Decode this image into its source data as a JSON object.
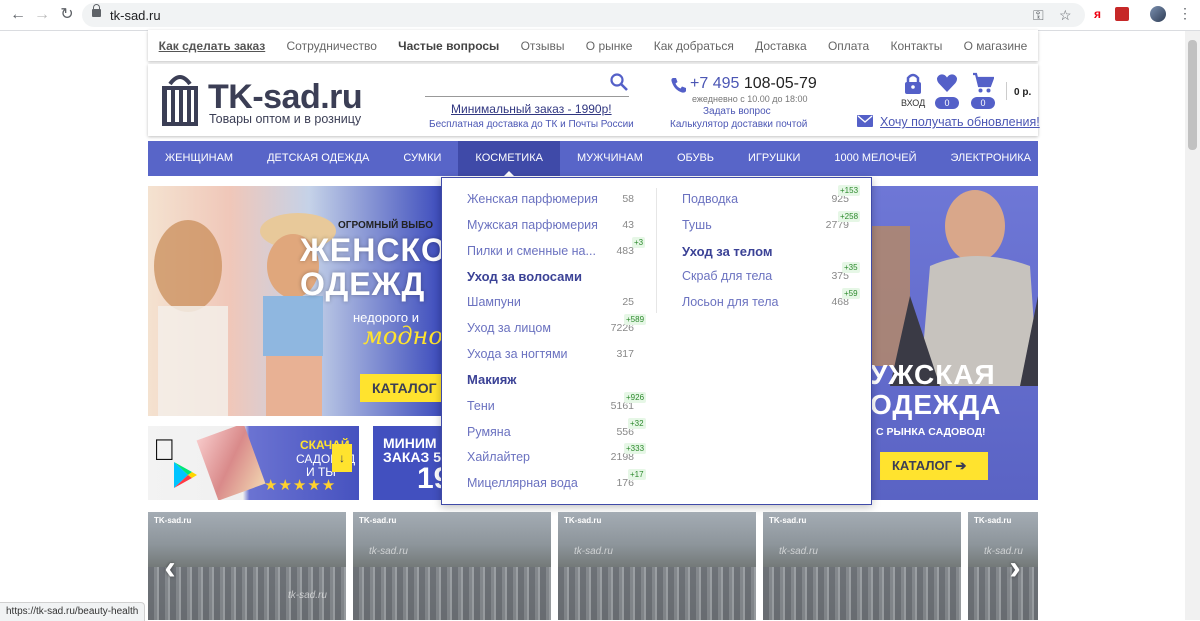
{
  "browser": {
    "url": "tk-sad.ru",
    "status_url": "https://tk-sad.ru/beauty-health"
  },
  "top_links": [
    "Как сделать заказ",
    "Сотрудничество",
    "Частые вопросы",
    "Отзывы",
    "О рынке",
    "Как добраться",
    "Доставка",
    "Оплата",
    "Контакты",
    "О магазине"
  ],
  "header": {
    "logo_text": "TK-sad.ru",
    "logo_sub": "Товары оптом и в розницу",
    "min_order": "Минимальный заказ - 1990р!",
    "free_delivery": "Бесплатная доставка до ТК и Почты России",
    "phone_code": "+7 495",
    "phone_number": "108-05-79",
    "hours": "ежедневно с 10.00 до 18:00",
    "ask": "Задать вопрос",
    "calc": "Калькулятор доставки почтой",
    "login": "ВХОД",
    "fav_count": "0",
    "cart_count": "0",
    "cart_sum": "0 р.",
    "subscribe": "Хочу получать обновления!"
  },
  "main_nav": [
    "ЖЕНЩИНАМ",
    "ДЕТСКАЯ ОДЕЖДА",
    "СУМКИ",
    "КОСМЕТИКА",
    "МУЖЧИНАМ",
    "ОБУВЬ",
    "ИГРУШКИ",
    "1000 МЕЛОЧЕЙ",
    "ЭЛЕКТРОНИКА"
  ],
  "dropdown": {
    "left": [
      {
        "type": "item",
        "label": "Женская парфюмерия",
        "count": "58",
        "new": ""
      },
      {
        "type": "item",
        "label": "Мужская парфюмерия",
        "count": "43",
        "new": ""
      },
      {
        "type": "item",
        "label": "Пилки и сменные на...",
        "count": "483",
        "new": "+3"
      },
      {
        "type": "head",
        "label": "Уход за волосами"
      },
      {
        "type": "item",
        "label": "Шампуни",
        "count": "25",
        "new": ""
      },
      {
        "type": "item",
        "label": "Уход за лицом",
        "count": "7226",
        "new": "+589"
      },
      {
        "type": "item",
        "label": "Ухода за ногтями",
        "count": "317",
        "new": ""
      },
      {
        "type": "head",
        "label": "Макияж"
      },
      {
        "type": "item",
        "label": "Тени",
        "count": "5161",
        "new": "+926"
      },
      {
        "type": "item",
        "label": "Румяна",
        "count": "556",
        "new": "+32"
      },
      {
        "type": "item",
        "label": "Хайлайтер",
        "count": "2198",
        "new": "+333"
      },
      {
        "type": "item",
        "label": "Мицеллярная вода",
        "count": "176",
        "new": "+17"
      }
    ],
    "right": [
      {
        "type": "item",
        "label": "Подводка",
        "count": "925",
        "new": "+153"
      },
      {
        "type": "item",
        "label": "Тушь",
        "count": "2779",
        "new": "+258"
      },
      {
        "type": "head",
        "label": "Уход за телом"
      },
      {
        "type": "item",
        "label": "Скраб для тела",
        "count": "375",
        "new": "+35"
      },
      {
        "type": "item",
        "label": "Лосьон для тела",
        "count": "468",
        "new": "+59"
      }
    ]
  },
  "banners": {
    "left": {
      "line1": "ОГРОМНЫЙ ВЫБО",
      "line2": "ЖЕНСКО",
      "line3": "ОДЕЖД",
      "line4": "недорого и",
      "line5": "модно",
      "button": "КАТАЛОГ"
    },
    "right": {
      "line1": "УЖСКАЯ",
      "line2": "ОДЕЖДА",
      "line3": "С РЫНКА САДОВОД!",
      "button": "КАТАЛОГ ➔"
    },
    "app": {
      "line1": "СКАЧАЙ",
      "line2": "САДОВОД",
      "line3": "И ТЫ"
    },
    "min": {
      "line1": "МИНИМ",
      "line2": "ЗАКАЗ 5",
      "line3": "19"
    }
  },
  "thumbnails": {
    "logo": "TK-sad.ru",
    "watermark": "tk-sad.ru",
    "count": 5
  },
  "colors": {
    "nav_bg": "#5865c8",
    "nav_active": "#3f4aa8",
    "accent": "#4b56b4",
    "banner_button": "#ffe32e"
  }
}
